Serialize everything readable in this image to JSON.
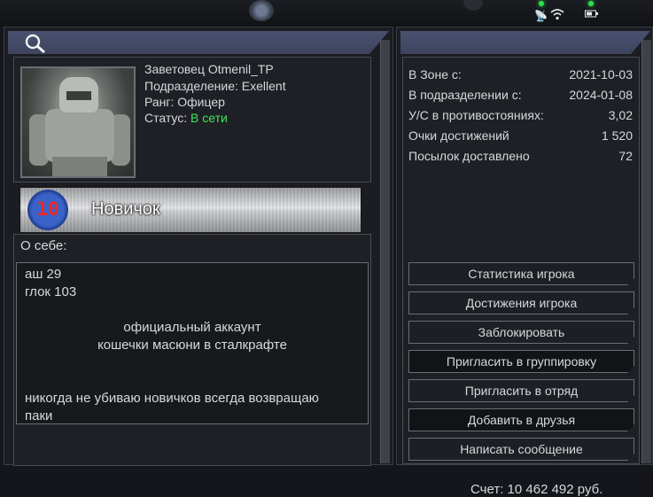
{
  "profile": {
    "name": "Заветовец Otmenil_TP",
    "division": "Подразделение: Exellent",
    "rank_line": "Ранг: Офицер",
    "status_label": "Статус:",
    "status_value": "В сети"
  },
  "rank_badge": {
    "number": "10",
    "title": "Новичок"
  },
  "about": {
    "label": "О себе:",
    "lines": [
      "аш 29",
      "глок 103",
      "официальный аккаунт",
      "кошечки масюни в сталкрафте",
      "никогда не убиваю новичков всегда возвращаю",
      "паки"
    ]
  },
  "stats": [
    {
      "label": "В Зоне с:",
      "value": "2021-10-03"
    },
    {
      "label": "В подразделении с:",
      "value": "2024-01-08"
    },
    {
      "label": "У/С в противостояниях:",
      "value": "3,02"
    },
    {
      "label": "Очки достижений",
      "value": "1 520"
    },
    {
      "label": "Посылок доставлено",
      "value": "72"
    }
  ],
  "buttons": [
    "Статистика игрока",
    "Достижения игрока",
    "Заблокировать",
    "Пригласить в группировку",
    "Пригласить в отряд",
    "Добавить в друзья",
    "Написать сообщение"
  ],
  "footer": {
    "account": "Счет: 10 462 492 руб."
  },
  "colors": {
    "accent": "#4a5170",
    "online": "#3fe65a",
    "rank_number": "#e82a2a"
  },
  "icons": {
    "header_left": "search-icon",
    "tray": [
      "antenna-icon",
      "wifi-icon",
      "battery-icon"
    ]
  }
}
